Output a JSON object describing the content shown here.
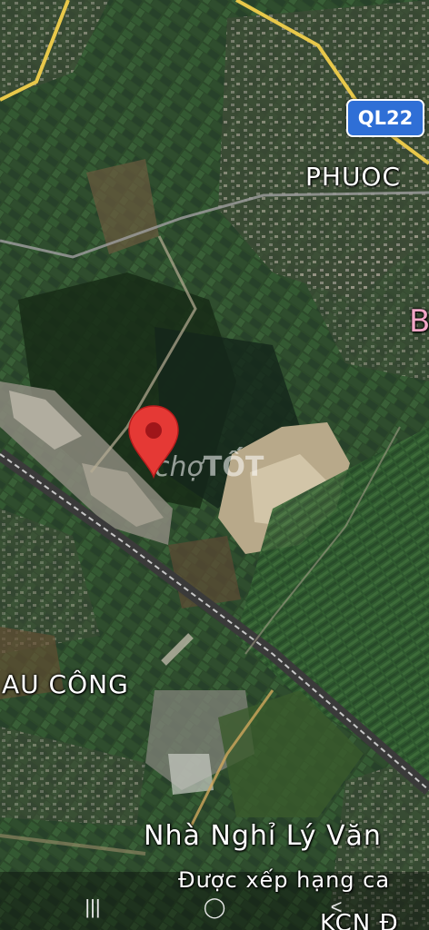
{
  "map": {
    "road_shield": "QL22",
    "labels": {
      "top_right": "PHUOC",
      "right_edge": "B",
      "left_area": "AU CÔNG",
      "place_title": "Nhà Nghỉ Lý Văn",
      "place_subtitle": "Được xếp hạng ca",
      "bottom": "KCN Đ"
    },
    "marker": {
      "icon": "location-pin-icon",
      "color": "#e53935"
    },
    "watermark": {
      "prefix": "chợ",
      "suffix": "TỐT"
    }
  },
  "navbar": {
    "recents": "|||",
    "home": "◯",
    "back": "<"
  }
}
